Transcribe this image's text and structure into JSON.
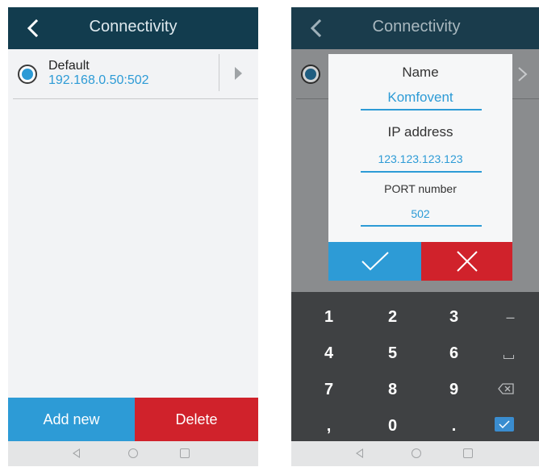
{
  "left": {
    "title": "Connectivity",
    "connection": {
      "name": "Default",
      "address": "192.168.0.50:502"
    },
    "add_button": "Add new",
    "delete_button": "Delete"
  },
  "right": {
    "title": "Connectivity",
    "dialog": {
      "name_label": "Name",
      "name_value": "Komfovent",
      "ip_label": "IP address",
      "ip_value": "123.123.123.123",
      "port_label": "PORT number",
      "port_value": "502"
    },
    "keyboard": {
      "keys": [
        "1",
        "2",
        "3",
        "–",
        "4",
        "5",
        "6",
        "7",
        "8",
        "9",
        ",",
        "0",
        "."
      ]
    }
  },
  "colors": {
    "appbar": "#123c4e",
    "accent_blue": "#2d9bd6",
    "accent_red": "#d0222b",
    "keyboard": "#3f4143"
  },
  "icons": [
    "back-chevron-icon",
    "right-arrow-icon",
    "checkmark-icon",
    "close-icon",
    "space-icon",
    "backspace-icon",
    "enter-icon",
    "nav-back-icon",
    "nav-home-icon",
    "nav-recent-icon"
  ]
}
